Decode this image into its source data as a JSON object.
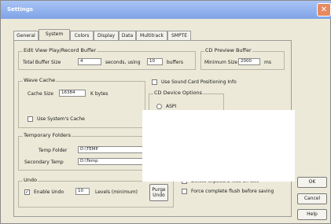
{
  "window": {
    "title": "Settings",
    "close_glyph": "✕"
  },
  "tabs": [
    "General",
    "System",
    "Colors",
    "Display",
    "Data",
    "Multitrack",
    "SMPTE"
  ],
  "active_tab": "System",
  "edit_buffer": {
    "title": "Edit View Play/Record Buffer",
    "total_label": "Total Buffer Size",
    "total_value": "4",
    "seconds_label": "seconds, using",
    "buffers_value": "10",
    "buffers_label": "buffers"
  },
  "cd_preview": {
    "title": "CD Preview Buffer",
    "min_label": "Minimum Size",
    "min_value": "2000",
    "unit": "ms"
  },
  "wave_cache": {
    "title": "Wave Cache",
    "cache_label": "Cache Size",
    "cache_value": "16384",
    "unit": "K bytes",
    "use_system": "Use System's Cache"
  },
  "positioning": {
    "label": "Use Sound Card Positioning Info",
    "device_options": "CD Device Options",
    "aspi": "ASPI"
  },
  "temp": {
    "title": "Temporary Folders",
    "temp_label": "Temp Folder",
    "temp_value": "D:\\TEMP",
    "secondary_label": "Secondary Temp",
    "secondary_value": "D:\\Temp"
  },
  "undo": {
    "title": "Undo",
    "enable_label": "Enable Undo",
    "levels_value": "10",
    "levels_label": "Levels (minimum)",
    "purge_label": "Purge Undo"
  },
  "options": {
    "delete_clipboard": "Delete clipboard files on exit",
    "force_flush": "Force complete flush before saving"
  },
  "buttons": {
    "ok": "OK",
    "cancel": "Cancel",
    "help": "Help"
  },
  "check_mark": "✓"
}
